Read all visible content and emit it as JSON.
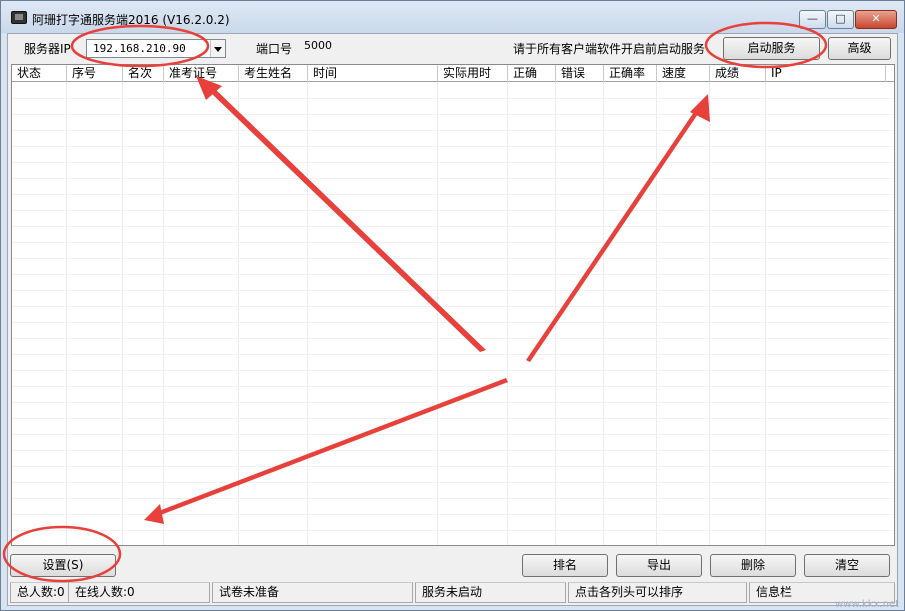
{
  "window": {
    "title": "阿珊打字通服务端2016 (V16.2.0.2)",
    "min_label": "—",
    "max_label": "□",
    "close_label": "✕"
  },
  "top_bar": {
    "server_ip_label": "服务器IP",
    "server_ip_value": "192.168.210.90",
    "port_label": "端口号",
    "port_value": "5000",
    "hint": "请于所有客户端软件开启前启动服务",
    "start_service_button": "启动服务",
    "advanced_button": "高级"
  },
  "table": {
    "columns": [
      "状态",
      "序号",
      "名次",
      "准考证号",
      "考生姓名",
      "时间",
      "实际用时",
      "正确",
      "错误",
      "正确率",
      "速度",
      "成绩",
      "IP"
    ],
    "rows": []
  },
  "bottom_bar": {
    "settings_button": "设置(S)",
    "rank_button": "排名",
    "export_button": "导出",
    "delete_button": "删除",
    "clear_button": "清空"
  },
  "status_bar": {
    "total": "总人数:0",
    "online": "在线人数:0",
    "exam_status": "试卷未准备",
    "service_status": "服务未启动",
    "sort_hint": "点击各列头可以排序",
    "info": "信息栏"
  },
  "watermark": "www.kkx.net",
  "colors": {
    "annotation_red": "#e8403a"
  }
}
